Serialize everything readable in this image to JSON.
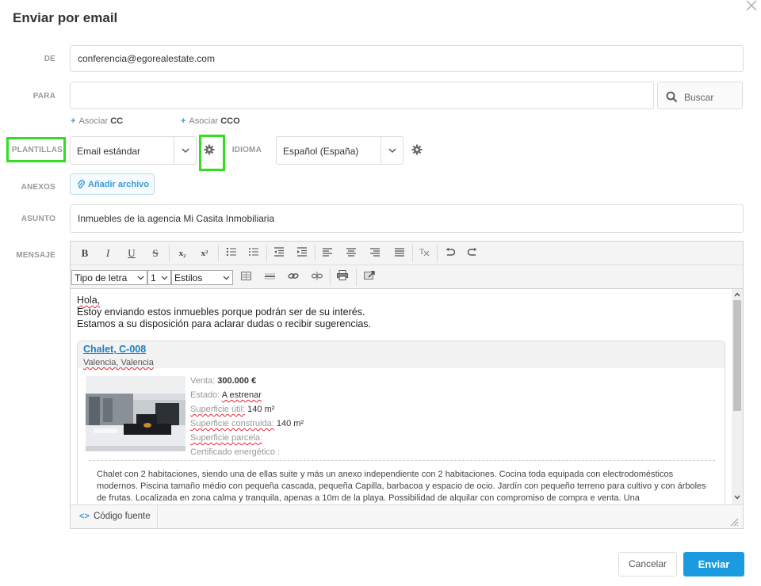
{
  "dialog": {
    "title": "Enviar por email"
  },
  "labels": {
    "from": "DE",
    "to": "PARA",
    "templates": "PLANTILLAS",
    "language": "IDIOMA",
    "attachments": "ANEXOS",
    "subject": "ASUNTO",
    "message": "MENSAJE"
  },
  "from_value": "conferencia@egorealestate.com",
  "to_value": "",
  "search_button": "Buscar",
  "associate_cc": {
    "prefix": "Asociar",
    "bold": "CC"
  },
  "associate_cco": {
    "prefix": "Asociar",
    "bold": "CCO"
  },
  "template_select": "Email estándar",
  "language_select": "Español (España)",
  "attach_button": "Añadir archivo",
  "subject_value": "Inmuebles de la agencia Mi Casita Inmobiliaria",
  "editor": {
    "toolbar": {
      "bold": "B",
      "italic": "I",
      "underline": "U",
      "strike": "S",
      "subscript": "x₂",
      "superscript": "x²",
      "font_select": "Tipo de letra",
      "size_select": "1",
      "styles_select": "Estilos"
    },
    "greeting": [
      "Hola,",
      "Estoy enviando estos inmuebles porque podrán ser de su interés.",
      "Estamos a su disposición para aclarar dudas o recibir sugerencias."
    ],
    "property": {
      "title": "Chalet, C-008",
      "location": "Valencia, Valencia",
      "sale_label": "Venta:",
      "sale_value": "300.000 €",
      "state_label": "Estado:",
      "state_value": "A estrenar",
      "useful_area_label": "Superficie útil:",
      "useful_area_value": "140 m²",
      "built_area_label": "Superficie construida:",
      "built_area_value": "140 m²",
      "plot_area_label": "Superficie parcela:",
      "energy_label": "Certificado energético :",
      "description": "Chalet con 2 habitaciones, siendo una de ellas suite y más un anexo independiente con 2 habitaciones. Cocina toda equipada con electrodomésticos modernos. Piscina tamaño médio con pequeña cascada, pequeña Capilla, barbacoa y espacio de ocio. Jardín con pequeño terreno para cultivo y con árboles de frutas. Localizada en zona calma y tranquila, apenas a 10m de la playa. Possibilidad de alquilar con compromiso de compra e venta. Una"
    },
    "source_button": "Código fuente"
  },
  "footer": {
    "cancel": "Cancelar",
    "send": "Enviar"
  },
  "colors": {
    "accent": "#1a9be0",
    "highlight": "#33dd22",
    "link": "#1b7fc4"
  }
}
